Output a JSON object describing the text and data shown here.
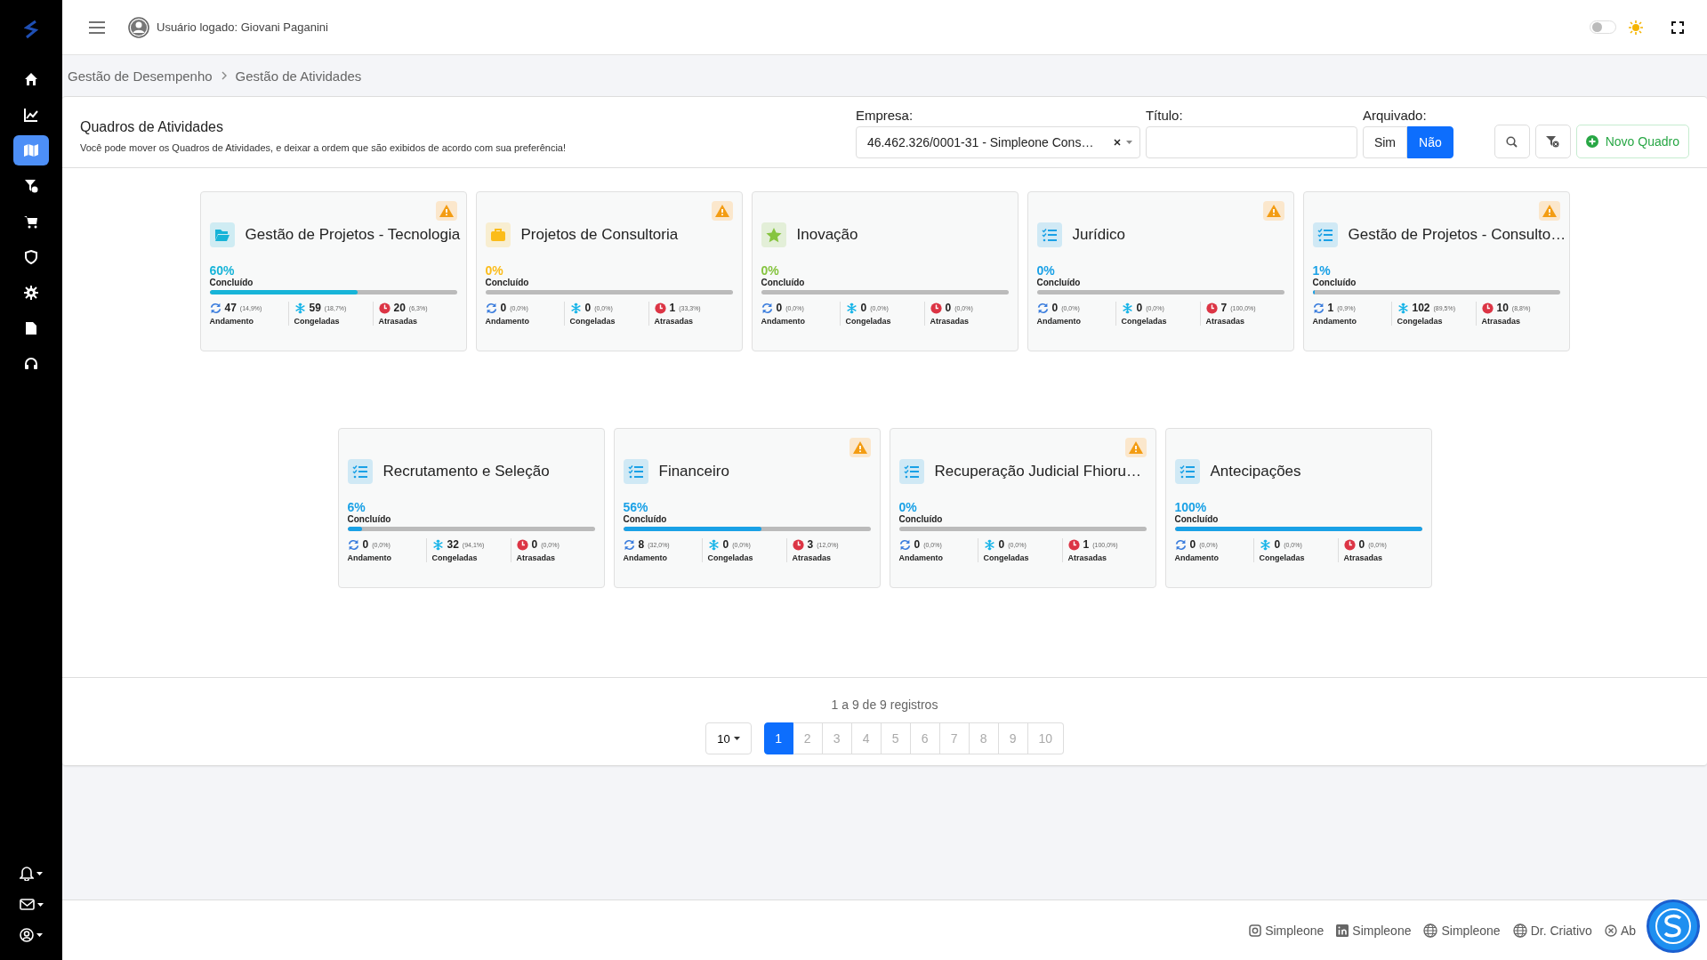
{
  "sidebar": {
    "items": [
      {
        "kind": "home",
        "selected": false
      },
      {
        "kind": "chart",
        "selected": false
      },
      {
        "kind": "map",
        "selected": true
      },
      {
        "kind": "filter",
        "selected": false
      },
      {
        "kind": "cart",
        "selected": false
      },
      {
        "kind": "shield",
        "selected": false
      },
      {
        "kind": "gear",
        "selected": false
      },
      {
        "kind": "document",
        "selected": false
      },
      {
        "kind": "headset",
        "selected": false
      }
    ],
    "bottom_items": [
      {
        "kind": "bell"
      },
      {
        "kind": "envelope"
      },
      {
        "kind": "user"
      }
    ]
  },
  "header": {
    "user": "Usuário logado: Giovani Paganini",
    "theme_dark": false
  },
  "breadcrumb": [
    "Gestão de Desempenho",
    "Gestão de Atividades"
  ],
  "panel": {
    "title": "Quadros de Atividades",
    "subtitle": "Você pode mover os Quadros de Atividades, e deixar a ordem que são exibidos de acordo com sua preferência!"
  },
  "filters": {
    "empresa": {
      "label": "Empresa:",
      "value": "46.462.326/0001-31 - Simpleone Cons…"
    },
    "titulo": {
      "label": "Título:"
    },
    "arquivado": {
      "label": "Arquivado:",
      "options": [
        {
          "label": "Sim",
          "selected": false
        },
        {
          "label": "Não",
          "selected": true
        }
      ]
    },
    "new_button": "Novo Quadro"
  },
  "boards": [
    {
      "title": "Gestão de Projetos - Tecnologia",
      "kind": "folder",
      "color": "#17b4d8",
      "warning": true,
      "percent": "60%",
      "level": 0.6,
      "done_label": "Concluído",
      "stats": [
        {
          "kind": "progress",
          "value": "47",
          "share": "(14,9%)",
          "label": "Andamento"
        },
        {
          "kind": "frozen",
          "value": "59",
          "share": "(18,7%)",
          "label": "Congeladas"
        },
        {
          "kind": "late",
          "value": "20",
          "share": "(6,3%)",
          "label": "Atrasadas"
        }
      ]
    },
    {
      "title": "Projetos de Consultoria",
      "kind": "briefcase",
      "color": "#fbbc1a",
      "warning": true,
      "percent": "0%",
      "level": 0,
      "done_label": "Concluído",
      "stats": [
        {
          "kind": "progress",
          "value": "0",
          "share": "(0,0%)",
          "label": "Andamento"
        },
        {
          "kind": "frozen",
          "value": "0",
          "share": "(0,0%)",
          "label": "Congeladas"
        },
        {
          "kind": "late",
          "value": "1",
          "share": "(33,3%)",
          "label": "Atrasadas"
        }
      ]
    },
    {
      "title": "Inovação",
      "kind": "star",
      "color": "#86c440",
      "warning": false,
      "percent": "0%",
      "level": 0,
      "done_label": "Concluído",
      "stats": [
        {
          "kind": "progress",
          "value": "0",
          "share": "(0,0%)",
          "label": "Andamento"
        },
        {
          "kind": "frozen",
          "value": "0",
          "share": "(0,0%)",
          "label": "Congeladas"
        },
        {
          "kind": "late",
          "value": "0",
          "share": "(0,0%)",
          "label": "Atrasadas"
        }
      ]
    },
    {
      "title": "Jurídico",
      "kind": "list",
      "color": "#1aa1e6",
      "warning": true,
      "percent": "0%",
      "level": 0,
      "done_label": "Concluído",
      "stats": [
        {
          "kind": "progress",
          "value": "0",
          "share": "(0,0%)",
          "label": "Andamento"
        },
        {
          "kind": "frozen",
          "value": "0",
          "share": "(0,0%)",
          "label": "Congeladas"
        },
        {
          "kind": "late",
          "value": "7",
          "share": "(100,0%)",
          "label": "Atrasadas"
        }
      ]
    },
    {
      "title": "Gestão de Projetos - Consulto…",
      "kind": "list",
      "color": "#1aa1e6",
      "warning": true,
      "percent": "1%",
      "level": 0.01,
      "done_label": "Concluído",
      "stats": [
        {
          "kind": "progress",
          "value": "1",
          "share": "(0,9%)",
          "label": "Andamento"
        },
        {
          "kind": "frozen",
          "value": "102",
          "share": "(89,5%)",
          "label": "Congeladas"
        },
        {
          "kind": "late",
          "value": "10",
          "share": "(8,8%)",
          "label": "Atrasadas"
        }
      ]
    },
    {
      "title": "Recrutamento e Seleção",
      "kind": "list",
      "color": "#1aa1e6",
      "warning": false,
      "percent": "6%",
      "level": 0.06,
      "done_label": "Concluído",
      "stats": [
        {
          "kind": "progress",
          "value": "0",
          "share": "(0,0%)",
          "label": "Andamento"
        },
        {
          "kind": "frozen",
          "value": "32",
          "share": "(94,1%)",
          "label": "Congeladas"
        },
        {
          "kind": "late",
          "value": "0",
          "share": "(0,0%)",
          "label": "Atrasadas"
        }
      ]
    },
    {
      "title": "Financeiro",
      "kind": "list",
      "color": "#1aa1e6",
      "warning": true,
      "percent": "56%",
      "level": 0.56,
      "done_label": "Concluído",
      "stats": [
        {
          "kind": "progress",
          "value": "8",
          "share": "(32,0%)",
          "label": "Andamento"
        },
        {
          "kind": "frozen",
          "value": "0",
          "share": "(0,0%)",
          "label": "Congeladas"
        },
        {
          "kind": "late",
          "value": "3",
          "share": "(12,0%)",
          "label": "Atrasadas"
        }
      ]
    },
    {
      "title": "Recuperação Judicial Fhioru…",
      "kind": "list",
      "color": "#1aa1e6",
      "warning": true,
      "percent": "0%",
      "level": 0,
      "done_label": "Concluído",
      "stats": [
        {
          "kind": "progress",
          "value": "0",
          "share": "(0,0%)",
          "label": "Andamento"
        },
        {
          "kind": "frozen",
          "value": "0",
          "share": "(0,0%)",
          "label": "Congeladas"
        },
        {
          "kind": "late",
          "value": "1",
          "share": "(100,0%)",
          "label": "Atrasadas"
        }
      ]
    },
    {
      "title": "Antecipações",
      "kind": "list",
      "color": "#1aa1e6",
      "warning": false,
      "percent": "100%",
      "level": 1,
      "done_label": "Concluído",
      "stats": [
        {
          "kind": "progress",
          "value": "0",
          "share": "(0,0%)",
          "label": "Andamento"
        },
        {
          "kind": "frozen",
          "value": "0",
          "share": "(0,0%)",
          "label": "Congeladas"
        },
        {
          "kind": "late",
          "value": "0",
          "share": "(0,0%)",
          "label": "Atrasadas"
        }
      ]
    }
  ],
  "pagination": {
    "summary": "1 a 9 de 9 registros",
    "per_page": "10",
    "pages": [
      {
        "label": "1",
        "selected": true
      },
      {
        "label": "2",
        "selected": false
      },
      {
        "label": "3",
        "selected": false
      },
      {
        "label": "4",
        "selected": false
      },
      {
        "label": "5",
        "selected": false
      },
      {
        "label": "6",
        "selected": false
      },
      {
        "label": "7",
        "selected": false
      },
      {
        "label": "8",
        "selected": false
      },
      {
        "label": "9",
        "selected": false
      },
      {
        "label": "10",
        "selected": false
      }
    ]
  },
  "footer": {
    "links": [
      {
        "kind": "instagram",
        "label": "Simpleone"
      },
      {
        "kind": "linkedin",
        "label": "Simpleone"
      },
      {
        "kind": "globe",
        "label": "Simpleone"
      },
      {
        "kind": "globe",
        "label": "Dr. Criativo"
      },
      {
        "kind": "circle-x",
        "label": "Ab"
      }
    ]
  }
}
